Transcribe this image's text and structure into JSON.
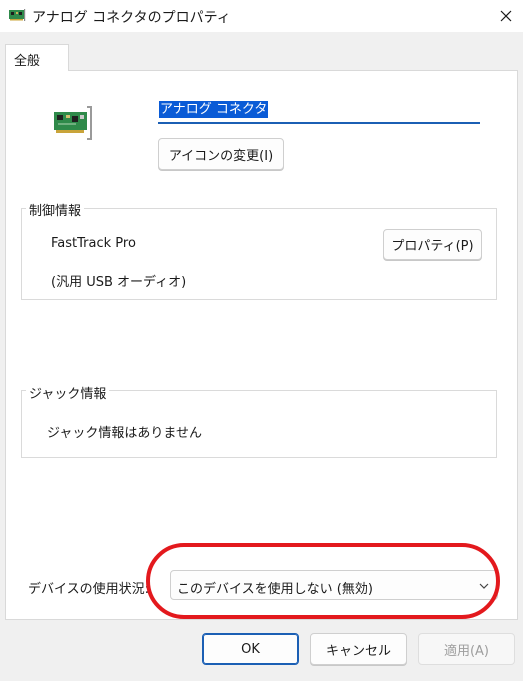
{
  "window": {
    "title": "アナログ コネクタのプロパティ",
    "icon": "sound-card-icon",
    "close_icon": "close-icon"
  },
  "tabs": [
    {
      "label": "全般",
      "selected": true
    }
  ],
  "general": {
    "device_name_value": "アナログ コネクタ",
    "change_icon_button": "アイコンの変更(I)",
    "control_info": {
      "title": "制御情報",
      "device": "FastTrack Pro",
      "driver": "(汎用 USB オーディオ)",
      "properties_button": "プロパティ(P)"
    },
    "jack_info": {
      "title": "ジャック情報",
      "text": "ジャック情報はありません"
    },
    "device_usage": {
      "label": "デバイスの使用状況:",
      "selected": "このデバイスを使用しない (無効)"
    }
  },
  "footer": {
    "ok": "OK",
    "cancel": "キャンセル",
    "apply": "適用(A)"
  },
  "colors": {
    "accent": "#1b5fb4",
    "selection": "#0a5bd6",
    "annotation": "#e3191d"
  }
}
